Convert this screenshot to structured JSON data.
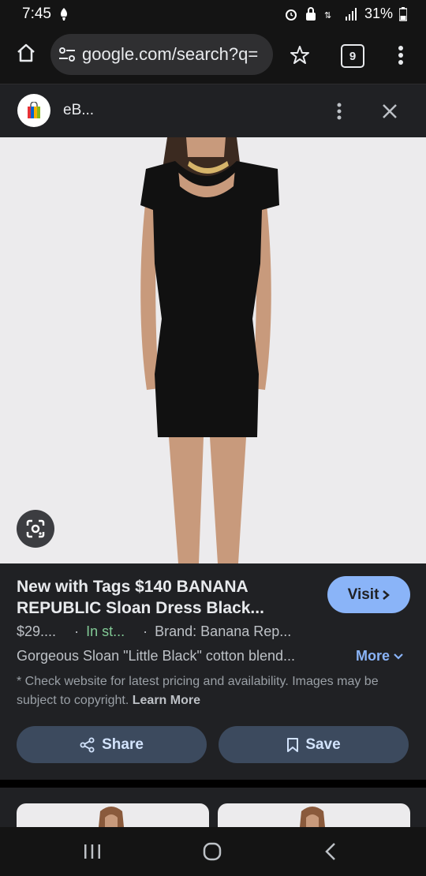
{
  "status_bar": {
    "time": "7:45",
    "battery": "31%"
  },
  "browser": {
    "url": "google.com/search?q=",
    "tab_count": "9"
  },
  "result_header": {
    "site_name": "eB..."
  },
  "product": {
    "title": "New with Tags $140 BANANA REPUBLIC Sloan Dress Black...",
    "price": "$29....",
    "stock": "In st...",
    "brand": "Brand: Banana Rep...",
    "description": "Gorgeous Sloan \"Little Black\" cotton blend...",
    "more_label": "More",
    "visit_label": "Visit",
    "disclaimer": "* Check website for latest pricing and availability. Images may be subject to copyright.",
    "learn_more": "Learn More",
    "share_label": "Share",
    "save_label": "Save"
  },
  "colors": {
    "accent": "#8ab4f8",
    "in_stock": "#81c995",
    "card_bg": "#202124",
    "button_bg": "#3c4a5e"
  },
  "icons": [
    "home-icon",
    "site-settings-icon",
    "star-icon",
    "tabs-icon",
    "more-vert-icon",
    "shopping-bag-icon",
    "close-icon",
    "lens-icon",
    "share-icon",
    "bookmark-icon",
    "recents-icon",
    "home-circle-icon",
    "back-icon"
  ]
}
